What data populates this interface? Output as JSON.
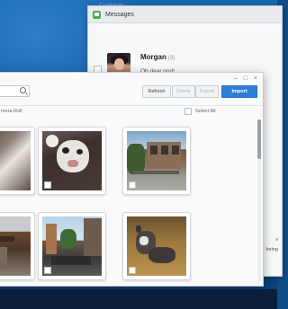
{
  "messages_window": {
    "title": "Messages",
    "ghost_title": "Contacts",
    "conversation": {
      "name": "Morgan",
      "count": "(3)",
      "preview": "Oh dear god!"
    },
    "side_text_1": "v",
    "side_text_2": "being"
  },
  "import_window": {
    "controls": {
      "minimize": "–",
      "maximize": "□",
      "close": "×"
    },
    "toolbar": {
      "refresh_label": "Refresh",
      "delete_label": "Delete",
      "export_label": "Export",
      "import_label": "Import"
    },
    "source_label": "mera Roll",
    "select_all_label": "Select All",
    "photos": [
      {
        "name": "dog-partial"
      },
      {
        "name": "dog-closeup"
      },
      {
        "name": "building-street"
      },
      {
        "name": "restaurant-patio"
      },
      {
        "name": "street-crowd"
      },
      {
        "name": "dog-on-couch"
      }
    ]
  },
  "colors": {
    "accent": "#2f7fd8",
    "desktop": "#0f4b86",
    "messages_icon": "#49b04c"
  }
}
